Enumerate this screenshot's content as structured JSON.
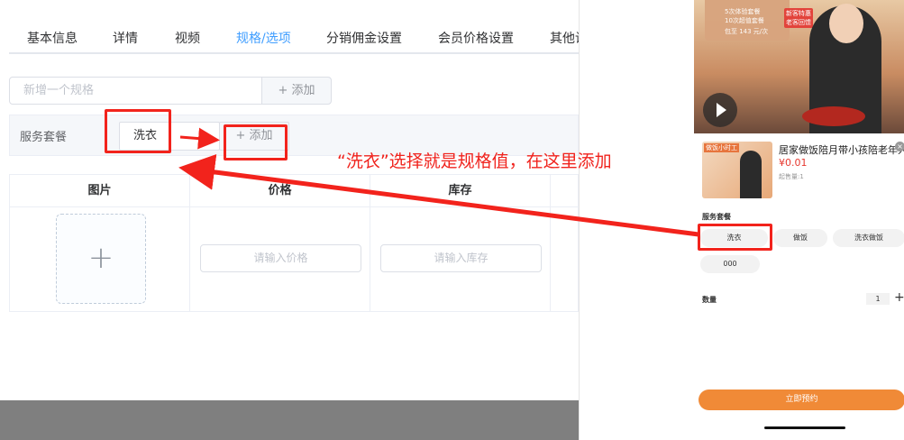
{
  "tabs": [
    {
      "label": "基本信息",
      "active": false
    },
    {
      "label": "详情",
      "active": false
    },
    {
      "label": "视频",
      "active": false
    },
    {
      "label": "规格/选项",
      "active": true
    },
    {
      "label": "分销佣金设置",
      "active": false
    },
    {
      "label": "会员价格设置",
      "active": false
    },
    {
      "label": "其他设置",
      "active": false
    }
  ],
  "spec": {
    "input_placeholder": "新增一个规格",
    "add_label": "+ 添加"
  },
  "package": {
    "label": "服务套餐",
    "tag": "洗衣",
    "add_label": "+ 添加"
  },
  "table": {
    "headers": [
      "图片",
      "价格",
      "库存"
    ],
    "upload_symbol": "+",
    "price_placeholder": "请输入价格",
    "stock_placeholder": "请输入库存"
  },
  "annotation": {
    "note": "“洗衣”选择就是规格值，在这里添加",
    "color": "#f2231c"
  },
  "preview": {
    "video_card_lines": [
      "5次体验套餐",
      "10次超值套餐",
      "包至 143 元/次"
    ],
    "video_badges": [
      "新客特惠",
      "老客回馈"
    ],
    "thumb_label": "做饭小时工",
    "product_title": "居家做饭陪月带小孩陪老年人",
    "price": "¥0.01",
    "min_buy": "起售量:1",
    "section_label": "服务套餐",
    "options": [
      "洗衣",
      "做饭",
      "洗衣做饭",
      "000"
    ],
    "qty_label": "数量",
    "qty_value": "1",
    "qty_plus": "+",
    "reserve_label": "立即预约",
    "accent_color": "#f08a37",
    "price_color": "#e6382f"
  }
}
